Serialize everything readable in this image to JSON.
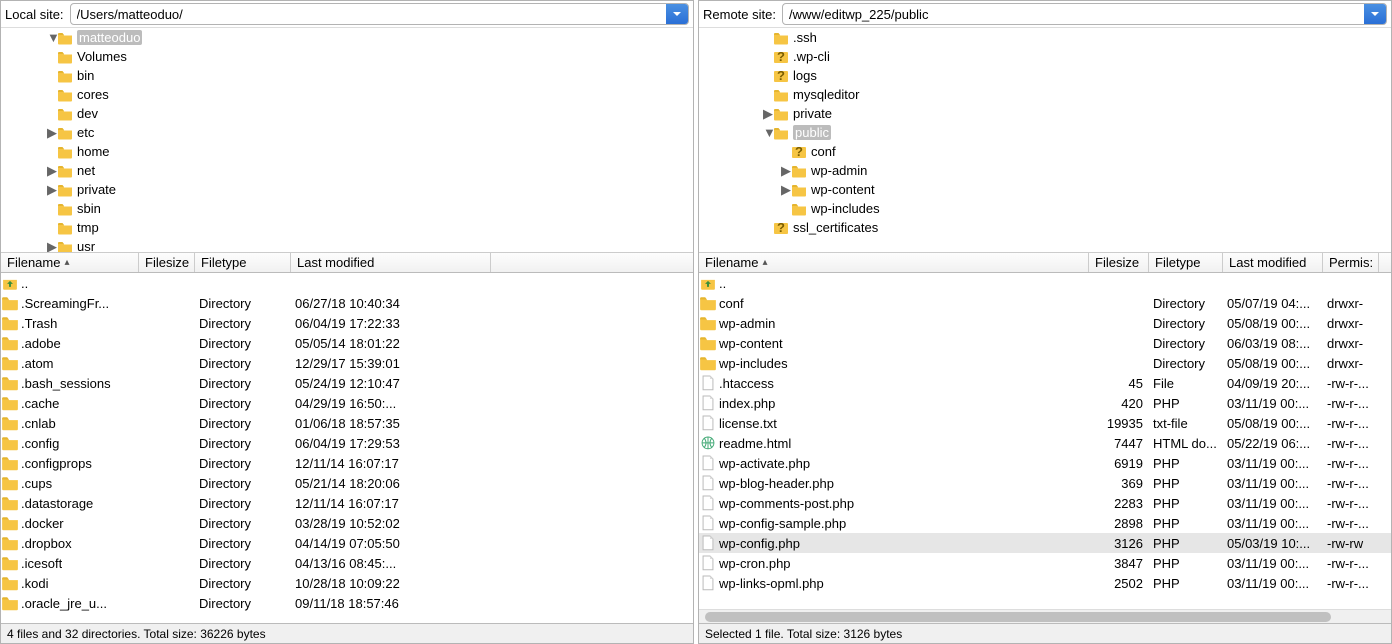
{
  "local": {
    "label": "Local site:",
    "path": "/Users/matteoduo/",
    "tree": [
      {
        "indent": 2,
        "icon": "folder",
        "label": "matteoduo",
        "selected": true,
        "expand": "expanded"
      },
      {
        "indent": 2,
        "icon": "folder",
        "label": "Volumes"
      },
      {
        "indent": 2,
        "icon": "folder",
        "label": "bin"
      },
      {
        "indent": 2,
        "icon": "folder",
        "label": "cores"
      },
      {
        "indent": 2,
        "icon": "folder",
        "label": "dev"
      },
      {
        "indent": 2,
        "icon": "folder",
        "label": "etc",
        "expand": "collapsed"
      },
      {
        "indent": 2,
        "icon": "folder",
        "label": "home"
      },
      {
        "indent": 2,
        "icon": "folder",
        "label": "net",
        "expand": "collapsed"
      },
      {
        "indent": 2,
        "icon": "folder",
        "label": "private",
        "expand": "collapsed"
      },
      {
        "indent": 2,
        "icon": "folder",
        "label": "sbin"
      },
      {
        "indent": 2,
        "icon": "folder",
        "label": "tmp"
      },
      {
        "indent": 2,
        "icon": "folder",
        "label": "usr",
        "expand": "collapsed"
      }
    ],
    "headers": {
      "name": "Filename",
      "size": "Filesize",
      "type": "Filetype",
      "mod": "Last modified"
    },
    "files": [
      {
        "icon": "up",
        "name": "..",
        "size": "",
        "type": "",
        "mod": ""
      },
      {
        "icon": "folder",
        "name": ".ScreamingFr...",
        "size": "",
        "type": "Directory",
        "mod": "06/27/18 10:40:34"
      },
      {
        "icon": "folder",
        "name": ".Trash",
        "size": "",
        "type": "Directory",
        "mod": "06/04/19 17:22:33"
      },
      {
        "icon": "folder",
        "name": ".adobe",
        "size": "",
        "type": "Directory",
        "mod": "05/05/14 18:01:22"
      },
      {
        "icon": "folder",
        "name": ".atom",
        "size": "",
        "type": "Directory",
        "mod": "12/29/17 15:39:01"
      },
      {
        "icon": "folder",
        "name": ".bash_sessions",
        "size": "",
        "type": "Directory",
        "mod": "05/24/19 12:10:47"
      },
      {
        "icon": "folder",
        "name": ".cache",
        "size": "",
        "type": "Directory",
        "mod": "04/29/19 16:50:..."
      },
      {
        "icon": "folder",
        "name": ".cnlab",
        "size": "",
        "type": "Directory",
        "mod": "01/06/18 18:57:35"
      },
      {
        "icon": "folder",
        "name": ".config",
        "size": "",
        "type": "Directory",
        "mod": "06/04/19 17:29:53"
      },
      {
        "icon": "folder",
        "name": ".configprops",
        "size": "",
        "type": "Directory",
        "mod": "12/11/14 16:07:17"
      },
      {
        "icon": "folder",
        "name": ".cups",
        "size": "",
        "type": "Directory",
        "mod": "05/21/14 18:20:06"
      },
      {
        "icon": "folder",
        "name": ".datastorage",
        "size": "",
        "type": "Directory",
        "mod": "12/11/14 16:07:17"
      },
      {
        "icon": "folder",
        "name": ".docker",
        "size": "",
        "type": "Directory",
        "mod": "03/28/19 10:52:02"
      },
      {
        "icon": "folder",
        "name": ".dropbox",
        "size": "",
        "type": "Directory",
        "mod": "04/14/19 07:05:50"
      },
      {
        "icon": "folder",
        "name": ".icesoft",
        "size": "",
        "type": "Directory",
        "mod": "04/13/16 08:45:..."
      },
      {
        "icon": "folder",
        "name": ".kodi",
        "size": "",
        "type": "Directory",
        "mod": "10/28/18 10:09:22"
      },
      {
        "icon": "folder",
        "name": ".oracle_jre_u...",
        "size": "",
        "type": "Directory",
        "mod": "09/11/18 18:57:46"
      }
    ],
    "status": "4 files and 32 directories. Total size: 36226 bytes"
  },
  "remote": {
    "label": "Remote site:",
    "path": "/www/editwp_225/public",
    "tree": [
      {
        "indent": 3,
        "icon": "folder",
        "label": ".ssh"
      },
      {
        "indent": 3,
        "icon": "qfolder",
        "label": ".wp-cli"
      },
      {
        "indent": 3,
        "icon": "qfolder",
        "label": "logs"
      },
      {
        "indent": 3,
        "icon": "folder",
        "label": "mysqleditor"
      },
      {
        "indent": 3,
        "icon": "folder",
        "label": "private",
        "expand": "collapsed"
      },
      {
        "indent": 3,
        "icon": "folder",
        "label": "public",
        "selected": true,
        "expand": "expanded"
      },
      {
        "indent": 4,
        "icon": "qfolder",
        "label": "conf"
      },
      {
        "indent": 4,
        "icon": "folder",
        "label": "wp-admin",
        "expand": "collapsed"
      },
      {
        "indent": 4,
        "icon": "folder",
        "label": "wp-content",
        "expand": "collapsed"
      },
      {
        "indent": 4,
        "icon": "folder",
        "label": "wp-includes"
      },
      {
        "indent": 3,
        "icon": "qfolder",
        "label": "ssl_certificates"
      }
    ],
    "headers": {
      "name": "Filename",
      "size": "Filesize",
      "type": "Filetype",
      "mod": "Last modified",
      "perm": "Permis:"
    },
    "files": [
      {
        "icon": "up",
        "name": "..",
        "size": "",
        "type": "",
        "mod": "",
        "perm": ""
      },
      {
        "icon": "folder",
        "name": "conf",
        "size": "",
        "type": "Directory",
        "mod": "05/07/19 04:...",
        "perm": "drwxr-"
      },
      {
        "icon": "folder",
        "name": "wp-admin",
        "size": "",
        "type": "Directory",
        "mod": "05/08/19 00:...",
        "perm": "drwxr-"
      },
      {
        "icon": "folder",
        "name": "wp-content",
        "size": "",
        "type": "Directory",
        "mod": "06/03/19 08:...",
        "perm": "drwxr-"
      },
      {
        "icon": "folder",
        "name": "wp-includes",
        "size": "",
        "type": "Directory",
        "mod": "05/08/19 00:...",
        "perm": "drwxr-"
      },
      {
        "icon": "file",
        "name": ".htaccess",
        "size": "45",
        "type": "File",
        "mod": "04/09/19 20:...",
        "perm": "-rw-r-..."
      },
      {
        "icon": "file",
        "name": "index.php",
        "size": "420",
        "type": "PHP",
        "mod": "03/11/19 00:...",
        "perm": "-rw-r-..."
      },
      {
        "icon": "file",
        "name": "license.txt",
        "size": "19935",
        "type": "txt-file",
        "mod": "05/08/19 00:...",
        "perm": "-rw-r-..."
      },
      {
        "icon": "html",
        "name": "readme.html",
        "size": "7447",
        "type": "HTML do...",
        "mod": "05/22/19 06:...",
        "perm": "-rw-r-..."
      },
      {
        "icon": "file",
        "name": "wp-activate.php",
        "size": "6919",
        "type": "PHP",
        "mod": "03/11/19 00:...",
        "perm": "-rw-r-..."
      },
      {
        "icon": "file",
        "name": "wp-blog-header.php",
        "size": "369",
        "type": "PHP",
        "mod": "03/11/19 00:...",
        "perm": "-rw-r-..."
      },
      {
        "icon": "file",
        "name": "wp-comments-post.php",
        "size": "2283",
        "type": "PHP",
        "mod": "03/11/19 00:...",
        "perm": "-rw-r-..."
      },
      {
        "icon": "file",
        "name": "wp-config-sample.php",
        "size": "2898",
        "type": "PHP",
        "mod": "03/11/19 00:...",
        "perm": "-rw-r-..."
      },
      {
        "icon": "file",
        "name": "wp-config.php",
        "size": "3126",
        "type": "PHP",
        "mod": "05/03/19 10:...",
        "perm": "-rw-rw",
        "selected": true
      },
      {
        "icon": "file",
        "name": "wp-cron.php",
        "size": "3847",
        "type": "PHP",
        "mod": "03/11/19 00:...",
        "perm": "-rw-r-..."
      },
      {
        "icon": "file",
        "name": "wp-links-opml.php",
        "size": "2502",
        "type": "PHP",
        "mod": "03/11/19 00:...",
        "perm": "-rw-r-..."
      }
    ],
    "status": "Selected 1 file. Total size: 3126 bytes"
  }
}
